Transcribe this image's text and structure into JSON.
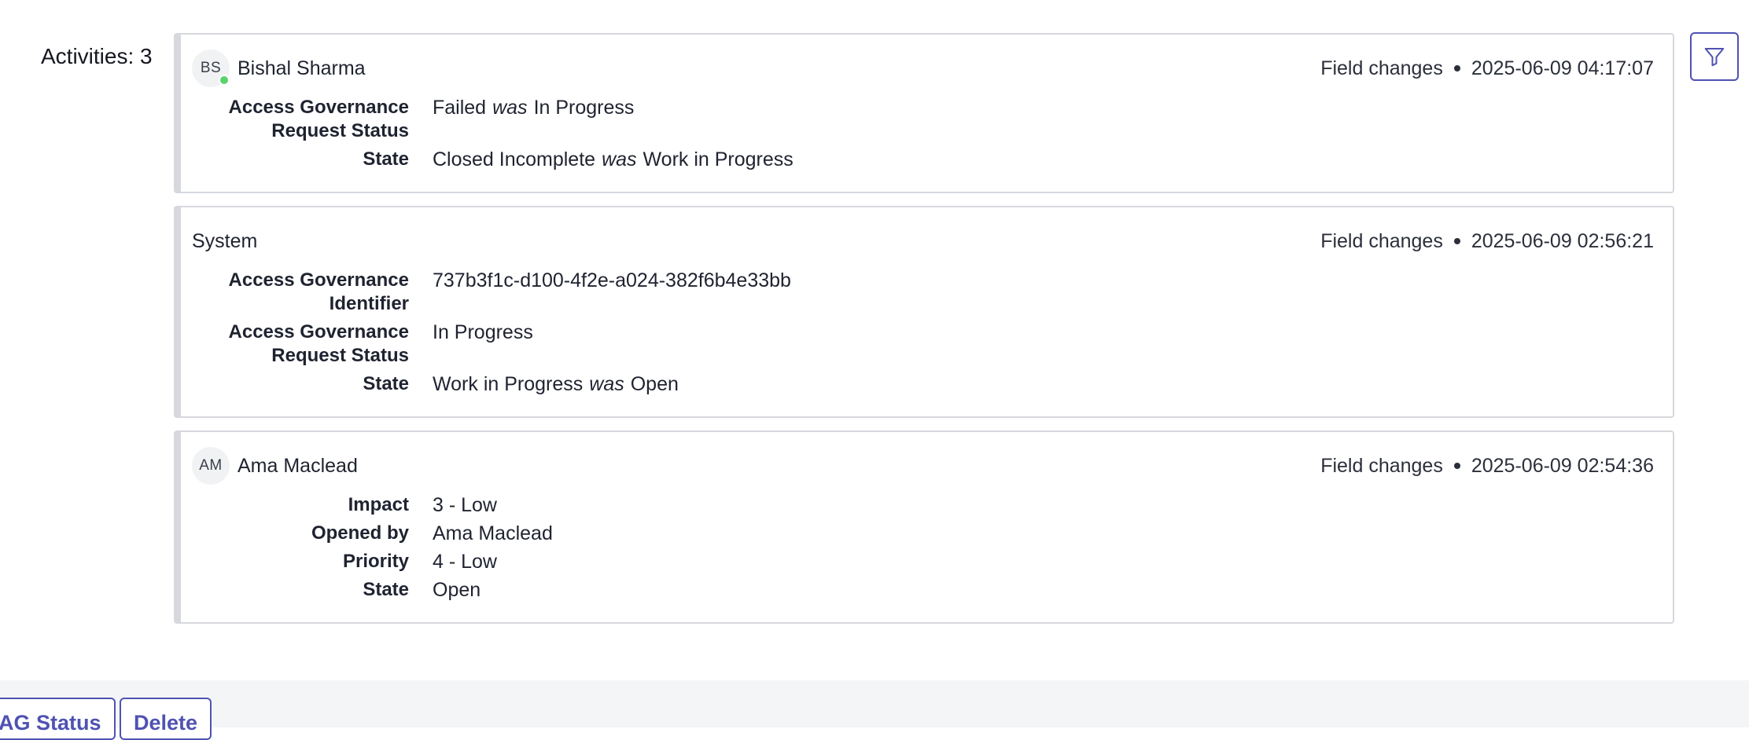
{
  "activities": {
    "label": "Activities: 3"
  },
  "entries": [
    {
      "author_initials": "BS",
      "author": "Bishal Sharma",
      "online": true,
      "type": "Field changes",
      "timestamp": "2025-06-09 04:17:07",
      "fields": [
        {
          "label_line1": "Access Governance",
          "label_line2": "Request Status",
          "new": "Failed",
          "was_word": "was",
          "old": "In Progress"
        },
        {
          "label_line1": "State",
          "label_line2": "",
          "new": "Closed Incomplete",
          "was_word": "was",
          "old": "Work in Progress"
        }
      ]
    },
    {
      "author_initials": "",
      "author": "System",
      "online": false,
      "type": "Field changes",
      "timestamp": "2025-06-09 02:56:21",
      "fields": [
        {
          "label_line1": "Access Governance",
          "label_line2": "Identifier",
          "new": "737b3f1c-d100-4f2e-a024-382f6b4e33bb",
          "was_word": "",
          "old": ""
        },
        {
          "label_line1": "Access Governance",
          "label_line2": "Request Status",
          "new": "In Progress",
          "was_word": "",
          "old": ""
        },
        {
          "label_line1": "State",
          "label_line2": "",
          "new": "Work in Progress",
          "was_word": "was",
          "old": "Open"
        }
      ]
    },
    {
      "author_initials": "AM",
      "author": "Ama Maclead",
      "online": false,
      "type": "Field changes",
      "timestamp": "2025-06-09 02:54:36",
      "fields": [
        {
          "label_line1": "Impact",
          "label_line2": "",
          "new": "3 - Low",
          "was_word": "",
          "old": ""
        },
        {
          "label_line1": "Opened by",
          "label_line2": "",
          "new": "Ama Maclead",
          "was_word": "",
          "old": ""
        },
        {
          "label_line1": "Priority",
          "label_line2": "",
          "new": "4 - Low",
          "was_word": "",
          "old": ""
        },
        {
          "label_line1": "State",
          "label_line2": "",
          "new": "Open",
          "was_word": "",
          "old": ""
        }
      ]
    }
  ],
  "filter": {
    "icon": "filter-icon"
  },
  "footer": {
    "buttons": [
      "AG Status",
      "Delete"
    ]
  },
  "colors": {
    "accent": "#4f52b2",
    "card_border": "#d6d8de",
    "presence_online": "#59d36b",
    "footer_bg": "#f4f5f7"
  }
}
